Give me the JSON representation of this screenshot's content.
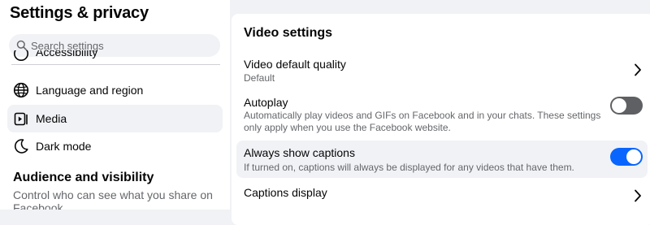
{
  "sidebar": {
    "title": "Settings & privacy",
    "search": {
      "placeholder": "Search settings",
      "value": ""
    },
    "partial_item": {
      "label": "Accessibility",
      "icon": "accessibility-icon"
    },
    "items": [
      {
        "label": "Language and region",
        "icon": "globe-icon",
        "active": false
      },
      {
        "label": "Media",
        "icon": "media-icon",
        "active": true
      },
      {
        "label": "Dark mode",
        "icon": "moon-icon",
        "active": false
      }
    ],
    "section": {
      "heading": "Audience and visibility",
      "description": "Control who can see what you share on Facebook."
    }
  },
  "main": {
    "title": "Video settings",
    "settings": [
      {
        "title": "Video default quality",
        "subtitle": "Default",
        "control": "chevron"
      },
      {
        "title": "Autoplay",
        "subtitle": "Automatically play videos and GIFs on Facebook and in your chats. These settings only apply when you use the Facebook website.",
        "control": "toggle",
        "on": false
      },
      {
        "title": "Always show captions",
        "subtitle": "If turned on, captions will always be displayed for any videos that have them.",
        "control": "toggle",
        "on": true
      },
      {
        "title": "Captions display",
        "subtitle": "",
        "control": "chevron"
      }
    ]
  },
  "colors": {
    "accent": "#0866ff",
    "toggle_off": "#5f6063",
    "secondary_text": "#65676b",
    "active_background": "#f0f2f5"
  }
}
